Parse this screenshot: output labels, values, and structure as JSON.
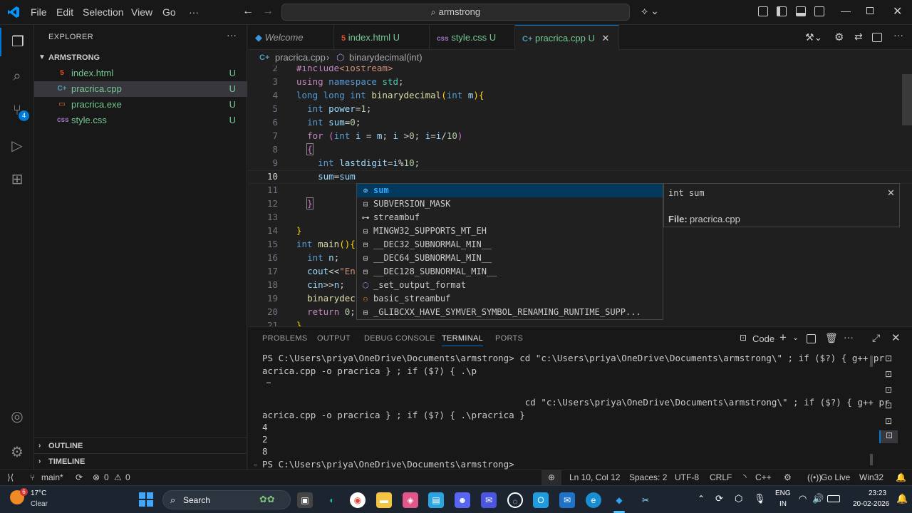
{
  "titlebar": {
    "menus": [
      "File",
      "Edit",
      "Selection",
      "View",
      "Go",
      "···"
    ],
    "search": "armstrong"
  },
  "activity": {
    "badge": "4"
  },
  "explorer": {
    "title": "EXPLORER",
    "folder": "ARMSTRONG",
    "files": [
      {
        "name": "index.html",
        "status": "U",
        "icon": "html-icon"
      },
      {
        "name": "pracrica.cpp",
        "status": "U",
        "icon": "cpp-icon"
      },
      {
        "name": "pracrica.exe",
        "status": "U",
        "icon": "exe-icon"
      },
      {
        "name": "style.css",
        "status": "U",
        "icon": "css-icon"
      }
    ],
    "outline": "OUTLINE",
    "timeline": "TIMELINE"
  },
  "tabs": [
    {
      "label": "Welcome",
      "status": ""
    },
    {
      "label": "index.html",
      "status": "U"
    },
    {
      "label": "style.css",
      "status": "U"
    },
    {
      "label": "pracrica.cpp",
      "status": "U"
    }
  ],
  "breadcrumb": {
    "file": "pracrica.cpp",
    "symbol": "binarydecimal(int)"
  },
  "editor": {
    "line_numbers": [
      "2",
      "3",
      "4",
      "5",
      "6",
      "7",
      "8",
      "9",
      "10",
      "11",
      "12",
      "13",
      "14",
      "15",
      "16",
      "17",
      "18",
      "19",
      "20",
      "21"
    ]
  },
  "suggest": {
    "items": [
      "sum",
      "SUBVERSION_MASK",
      "streambuf",
      "MINGW32_SUPPORTS_MT_EH",
      "__DEC32_SUBNORMAL_MIN__",
      "__DEC64_SUBNORMAL_MIN__",
      "__DEC128_SUBNORMAL_MIN__",
      "_set_output_format",
      "basic_streambuf",
      "_GLIBCXX_HAVE_SYMVER_SYMBOL_RENAMING_RUNTIME_SUPP..."
    ],
    "detail_sig": "int sum",
    "detail_file_label": "File:",
    "detail_file": "pracrica.cpp"
  },
  "panel": {
    "tabs": [
      "PROBLEMS",
      "OUTPUT",
      "DEBUG CONSOLE",
      "TERMINAL",
      "PORTS"
    ],
    "shell_label": "Code",
    "lines": [
      "PS C:\\Users\\priya\\OneDrive\\Documents\\armstrong> cd \"c:\\Users\\priya\\OneDrive\\Documents\\armstrong\\\" ; if ($?) { g++ pr",
      "acrica.cpp -o pracrica } ; if ($?) { .\\p",
      " …",
      "                                                 cd \"c:\\Users\\priya\\OneDrive\\Documents\\armstrong\\\" ; if ($?) { g++ pr",
      "acrica.cpp -o pracrica } ; if ($?) { .\\pracrica }",
      "4",
      "2",
      "8",
      "PS C:\\Users\\priya\\OneDrive\\Documents\\armstrong> "
    ]
  },
  "status": {
    "branch": "main*",
    "errors": "0",
    "warnings": "0",
    "position": "Ln 10, Col 12",
    "spaces": "Spaces: 2",
    "encoding": "UTF-8",
    "eol": "CRLF",
    "lang": "C++",
    "golive": "Go Live",
    "platform": "Win32"
  },
  "taskbar": {
    "weather_badge": "6",
    "temp": "17°C",
    "condition": "Clear",
    "search": "Search",
    "lang1": "ENG",
    "lang2": "IN",
    "time": "23:23",
    "date": "20-02-2026"
  },
  "colors": {
    "accent": "#0078d4",
    "modified": "#73c991",
    "background": "#1f1f1f"
  }
}
